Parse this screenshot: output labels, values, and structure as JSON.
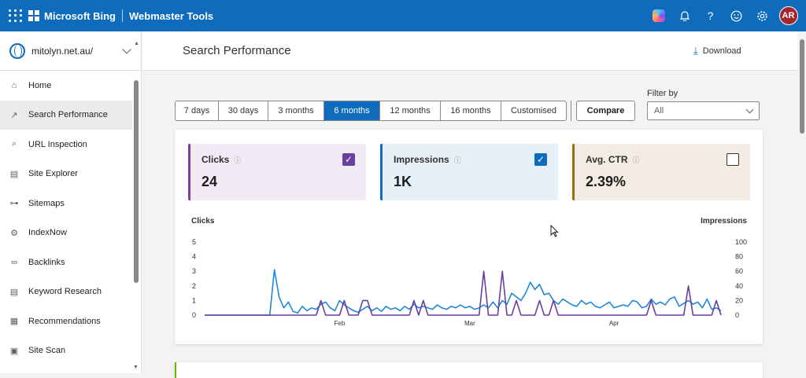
{
  "topbar": {
    "brand": "Microsoft Bing",
    "product": "Webmaster Tools",
    "avatar_initials": "AR",
    "icons": [
      "copilot-icon",
      "bell-icon",
      "help-icon",
      "smiley-icon",
      "gear-icon"
    ]
  },
  "sidebar": {
    "site": "mitolyn.net.au/",
    "items": [
      {
        "label": "Home",
        "icon": "home-icon",
        "glyph": "⌂"
      },
      {
        "label": "Search Performance",
        "icon": "trend-icon",
        "glyph": "↗"
      },
      {
        "label": "URL Inspection",
        "icon": "search-icon",
        "glyph": "⌕"
      },
      {
        "label": "Site Explorer",
        "icon": "document-icon",
        "glyph": "▤"
      },
      {
        "label": "Sitemaps",
        "icon": "sitemap-icon",
        "glyph": "⊶"
      },
      {
        "label": "IndexNow",
        "icon": "gear-icon",
        "glyph": "⚙"
      },
      {
        "label": "Backlinks",
        "icon": "link-icon",
        "glyph": "∞"
      },
      {
        "label": "Keyword Research",
        "icon": "list-icon",
        "glyph": "▤"
      },
      {
        "label": "Recommendations",
        "icon": "checklist-icon",
        "glyph": "▦"
      },
      {
        "label": "Site Scan",
        "icon": "scan-icon",
        "glyph": "▣"
      }
    ],
    "active_index": 1
  },
  "header": {
    "title": "Search Performance",
    "download_label": "Download"
  },
  "ranges": {
    "items": [
      "7 days",
      "30 days",
      "3 months",
      "6 months",
      "12 months",
      "16 months",
      "Customised"
    ],
    "selected": 3,
    "compare_label": "Compare"
  },
  "filter": {
    "label": "Filter by",
    "value": "All"
  },
  "metrics": {
    "clicks": {
      "label": "Clicks",
      "value": "24",
      "checked": true,
      "bg": "#f0ebf5",
      "accent": "#7a3fa3",
      "check_color": "#6b3fa0"
    },
    "impressions": {
      "label": "Impressions",
      "value": "1K",
      "checked": true,
      "bg": "#e6f0f9",
      "accent": "#0f6cbd",
      "check_color": "#0f6cbd"
    },
    "ctr": {
      "label": "Avg. CTR",
      "value": "2.39%",
      "checked": false,
      "bg": "#f3ece2",
      "accent": "#986f0b"
    }
  },
  "chart_data": {
    "type": "line",
    "left_axis_label": "Clicks",
    "right_axis_label": "Impressions",
    "left_ticks": [
      "0",
      "1",
      "2",
      "3",
      "4",
      "5"
    ],
    "right_ticks": [
      "0",
      "20",
      "40",
      "60",
      "80",
      "100"
    ],
    "left_range": [
      0,
      5
    ],
    "right_range": [
      0,
      100
    ],
    "x_labels": [
      {
        "label": "Feb",
        "index": 29
      },
      {
        "label": "Mar",
        "index": 57
      },
      {
        "label": "Apr",
        "index": 88
      }
    ],
    "series": [
      {
        "name": "Clicks",
        "axis": "left",
        "color": "#6b3fa0",
        "values": [
          0,
          0,
          0,
          0,
          0,
          0,
          0,
          0,
          0,
          0,
          0,
          0,
          0,
          0,
          0,
          0,
          0,
          0,
          0,
          0,
          0,
          0,
          0,
          0,
          0,
          1,
          0,
          0,
          0,
          0,
          1,
          0,
          0,
          0,
          1,
          1,
          0,
          0,
          0,
          0,
          0,
          0,
          0,
          0,
          0,
          1,
          0,
          1,
          0,
          0,
          0,
          0,
          0,
          0,
          0,
          0,
          0,
          0,
          0,
          0,
          3,
          0,
          0,
          0,
          3,
          0,
          0,
          1,
          0,
          0,
          0,
          0,
          1,
          0,
          0,
          1,
          0,
          0,
          0,
          0,
          0,
          0,
          0,
          0,
          0,
          0,
          0,
          0,
          0,
          0,
          0,
          0,
          0,
          0,
          0,
          0,
          1,
          0,
          0,
          0,
          0,
          0,
          0,
          0,
          2,
          0,
          0,
          0,
          0,
          0,
          1,
          0
        ]
      },
      {
        "name": "Impressions",
        "axis": "right",
        "color": "#1e88d6",
        "values": [
          0,
          0,
          0,
          0,
          0,
          0,
          0,
          0,
          0,
          0,
          0,
          0,
          0,
          0,
          0,
          62,
          25,
          10,
          18,
          5,
          3,
          12,
          6,
          10,
          8,
          15,
          18,
          10,
          6,
          20,
          14,
          10,
          6,
          4,
          8,
          12,
          6,
          10,
          5,
          12,
          8,
          10,
          6,
          12,
          8,
          15,
          10,
          12,
          10,
          8,
          14,
          10,
          8,
          12,
          10,
          14,
          10,
          12,
          8,
          10,
          14,
          10,
          18,
          10,
          20,
          15,
          30,
          25,
          20,
          30,
          45,
          35,
          42,
          28,
          30,
          20,
          15,
          22,
          18,
          14,
          12,
          20,
          15,
          18,
          12,
          10,
          14,
          18,
          10,
          12,
          14,
          12,
          20,
          18,
          10,
          12,
          22,
          15,
          18,
          14,
          22,
          25,
          12,
          16,
          20,
          15,
          18,
          10,
          22,
          8,
          10,
          6
        ]
      }
    ]
  }
}
